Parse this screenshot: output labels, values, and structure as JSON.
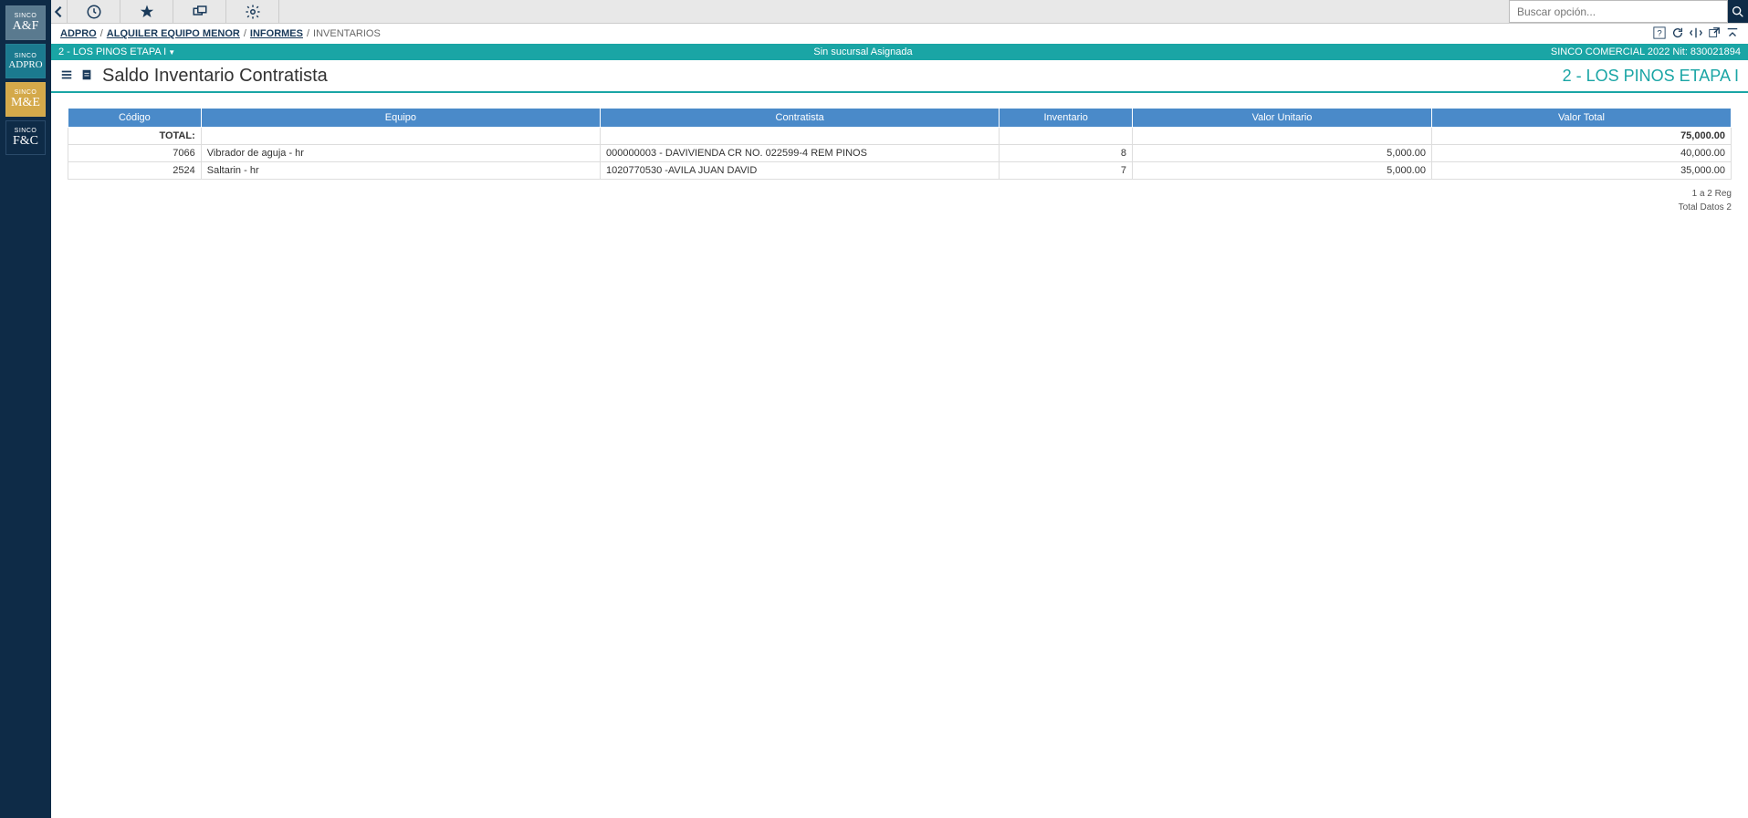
{
  "sidebar": {
    "items": [
      {
        "small": "SINCO",
        "big": "A&F",
        "cls": "tile-af"
      },
      {
        "small": "SINCO",
        "big": "ADPRO",
        "cls": "tile-adpro"
      },
      {
        "small": "SINCO",
        "big": "M&E",
        "cls": "tile-me"
      },
      {
        "small": "SINCO",
        "big": "F&C",
        "cls": "tile-fc"
      }
    ]
  },
  "search": {
    "placeholder": "Buscar opción..."
  },
  "breadcrumb": {
    "items": [
      "ADPRO",
      "ALQUILER EQUIPO MENOR",
      "INFORMES"
    ],
    "current": "INVENTARIOS"
  },
  "info_bar": {
    "left": "2 - LOS PINOS ETAPA I",
    "center": "Sin sucursal Asignada",
    "right": "SINCO COMERCIAL 2022 Nit: 830021894"
  },
  "page": {
    "title": "Saldo Inventario Contratista",
    "subtitle": "2 - LOS PINOS ETAPA I"
  },
  "table": {
    "headers": [
      "Código",
      "Equipo",
      "Contratista",
      "Inventario",
      "Valor Unitario",
      "Valor Total"
    ],
    "total_label": "TOTAL:",
    "total_value": "75,000.00",
    "rows": [
      {
        "codigo": "7066",
        "equipo": "Vibrador de aguja - hr",
        "contratista": "000000003 - DAVIVIENDA CR NO. 022599-4 REM PINOS",
        "inventario": "8",
        "valor_unit": "5,000.00",
        "valor_total": "40,000.00"
      },
      {
        "codigo": "2524",
        "equipo": "Saltarin - hr",
        "contratista": "1020770530 -AVILA JUAN DAVID",
        "inventario": "7",
        "valor_unit": "5,000.00",
        "valor_total": "35,000.00"
      }
    ],
    "footer1": "1 a 2 Reg",
    "footer2": "Total Datos 2"
  }
}
